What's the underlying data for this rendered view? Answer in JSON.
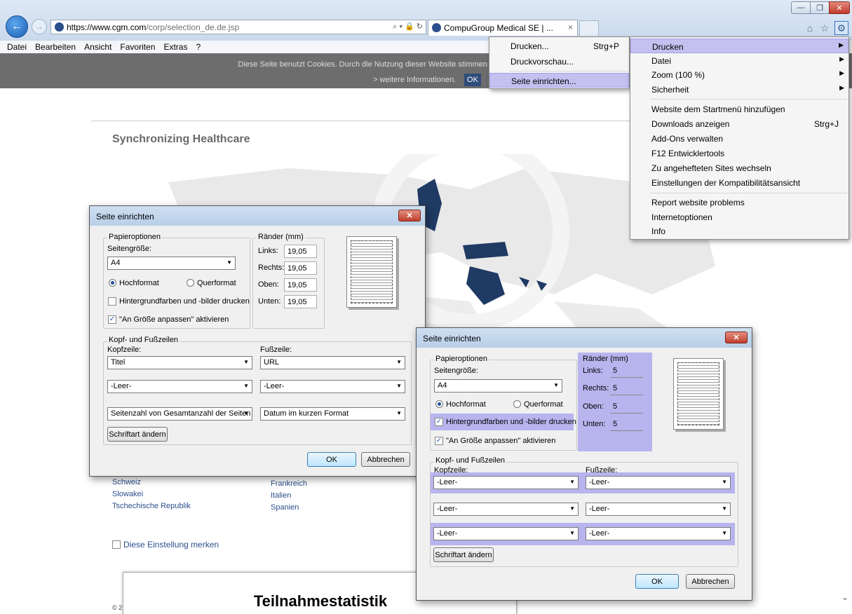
{
  "browser": {
    "url_host": "https://www.cgm.com",
    "url_path": "/corp/selection_de.de.jsp",
    "addr_tools": "⌕ ▾ 🔒 ↻",
    "tab_title": "CompuGroup Medical SE | ...",
    "tab_close": "×",
    "back_icon": "←",
    "fwd_icon": "→",
    "min_icon": "—",
    "max_icon": "❐",
    "close_icon": "✕",
    "home_icon": "⌂",
    "star_icon": "☆",
    "gear_icon": "⚙",
    "menubar": [
      "Datei",
      "Bearbeiten",
      "Ansicht",
      "Favoriten",
      "Extras",
      "?"
    ]
  },
  "page": {
    "cookie_text": "Diese Seite benutzt Cookies. Durch die Nutzung dieser Website stimmen",
    "cookie_more": "> weitere Informationen.",
    "cookie_ok": "OK",
    "title": "Synchronizing Healthcare",
    "countries_col1": [
      "Schweiz",
      "Slowakei",
      "Tschechische Republik"
    ],
    "countries_col2": [
      "Frankreich",
      "Italien",
      "Spanien"
    ],
    "remember": "Diese Einstellung merken",
    "footer_c": "© 2",
    "stat_title": "Teilnahmestatistik",
    "scroll_arrow": "⌄"
  },
  "print_submenu": {
    "items": [
      {
        "label": "Drucken...",
        "shortcut": "Strg+P"
      },
      {
        "label": "Druckvorschau...",
        "shortcut": ""
      },
      {
        "label": "Seite einrichten...",
        "shortcut": ""
      }
    ]
  },
  "tools_menu": {
    "items": [
      {
        "label": "Drucken",
        "shortcut": "",
        "arrow": "▶"
      },
      {
        "label": "Datei",
        "shortcut": "",
        "arrow": "▶"
      },
      {
        "label": "Zoom (100 %)",
        "shortcut": "",
        "arrow": "▶"
      },
      {
        "label": "Sicherheit",
        "shortcut": "",
        "arrow": "▶"
      },
      {
        "label": "Website dem Startmenü hinzufügen",
        "shortcut": "",
        "arrow": ""
      },
      {
        "label": "Downloads anzeigen",
        "shortcut": "Strg+J",
        "arrow": ""
      },
      {
        "label": "Add-Ons verwalten",
        "shortcut": "",
        "arrow": ""
      },
      {
        "label": "F12 Entwicklertools",
        "shortcut": "",
        "arrow": ""
      },
      {
        "label": "Zu angehefteten Sites wechseln",
        "shortcut": "",
        "arrow": ""
      },
      {
        "label": "Einstellungen der Kompatibilitätsansicht",
        "shortcut": "",
        "arrow": ""
      },
      {
        "label": "Report website problems",
        "shortcut": "",
        "arrow": ""
      },
      {
        "label": "Internetoptionen",
        "shortcut": "",
        "arrow": ""
      },
      {
        "label": "Info",
        "shortcut": "",
        "arrow": ""
      }
    ]
  },
  "dialog1": {
    "title": "Seite einrichten",
    "close": "✕",
    "paper_group": "Papieroptionen",
    "size_label": "Seitengröße:",
    "size_value": "A4",
    "portrait": "Hochformat",
    "landscape": "Querformat",
    "bg_print": "Hintergrundfarben und -bilder drucken",
    "bg_checked": false,
    "fit": "\"An Größe anpassen\" aktivieren",
    "fit_checked": true,
    "margins_group": "Ränder (mm)",
    "left_label": "Links:",
    "left": "19,05",
    "right_label": "Rechts:",
    "right": "19,05",
    "top_label": "Oben:",
    "top": "19,05",
    "bottom_label": "Unten:",
    "bottom": "19,05",
    "hf_group": "Kopf- und Fußzeilen",
    "header_label": "Kopfzeile:",
    "footer_label": "Fußzeile:",
    "header": [
      "Titel",
      "-Leer-",
      "Seitenzahl von Gesamtanzahl der Seiten"
    ],
    "footer": [
      "URL",
      "-Leer-",
      "Datum im kurzen Format"
    ],
    "font_btn": "Schriftart ändern",
    "ok": "OK",
    "cancel": "Abbrechen",
    "check": "✓"
  },
  "dialog2": {
    "title": "Seite einrichten",
    "close": "✕",
    "paper_group": "Papieroptionen",
    "size_label": "Seitengröße:",
    "size_value": "A4",
    "portrait": "Hochformat",
    "landscape": "Querformat",
    "bg_print": "Hintergrundfarben und -bilder drucken",
    "bg_checked": true,
    "fit": "\"An Größe anpassen\" aktivieren",
    "fit_checked": true,
    "margins_group": "Ränder (mm)",
    "left_label": "Links:",
    "left": "5",
    "right_label": "Rechts:",
    "right": "5",
    "top_label": "Oben:",
    "top": "5",
    "bottom_label": "Unten:",
    "bottom": "5",
    "hf_group": "Kopf- und Fußzeilen",
    "header_label": "Kopfzeile:",
    "footer_label": "Fußzeile:",
    "header": [
      "-Leer-",
      "-Leer-",
      "-Leer-"
    ],
    "footer": [
      "-Leer-",
      "-Leer-",
      "-Leer-"
    ],
    "font_btn": "Schriftart ändern",
    "ok": "OK",
    "cancel": "Abbrechen",
    "check": "✓"
  },
  "colors": {
    "highlight": "#b8b4ee",
    "menu_hover": "#c4c0f0",
    "map_land": "#e8e8e8",
    "map_accent": "#1f3a63",
    "link": "#2b4f8c"
  }
}
